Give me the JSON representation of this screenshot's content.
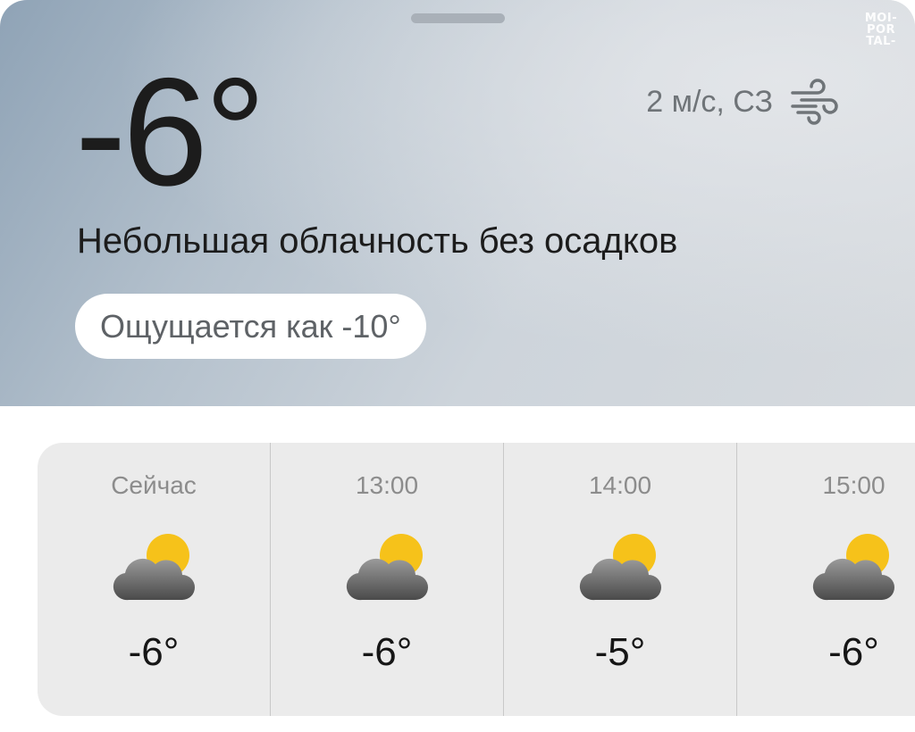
{
  "brand": {
    "logo_text": "MOI-\nPOR\nTAL-"
  },
  "current": {
    "temperature": "-6°",
    "wind": "2 м/с, СЗ",
    "condition": "Небольшая облачность без осадков",
    "feels_like": "Ощущается как -10°"
  },
  "icons": {
    "wind": "wind-icon",
    "partly_cloudy": "partly-cloudy-icon"
  },
  "colors": {
    "sun": "#f6c21a",
    "cloud_dark": "#4a4a4a",
    "cloud_light": "#9a9a9a"
  },
  "hourly": [
    {
      "time": "Сейчас",
      "temp": "-6°"
    },
    {
      "time": "13:00",
      "temp": "-6°"
    },
    {
      "time": "14:00",
      "temp": "-5°"
    },
    {
      "time": "15:00",
      "temp": "-6°"
    }
  ]
}
